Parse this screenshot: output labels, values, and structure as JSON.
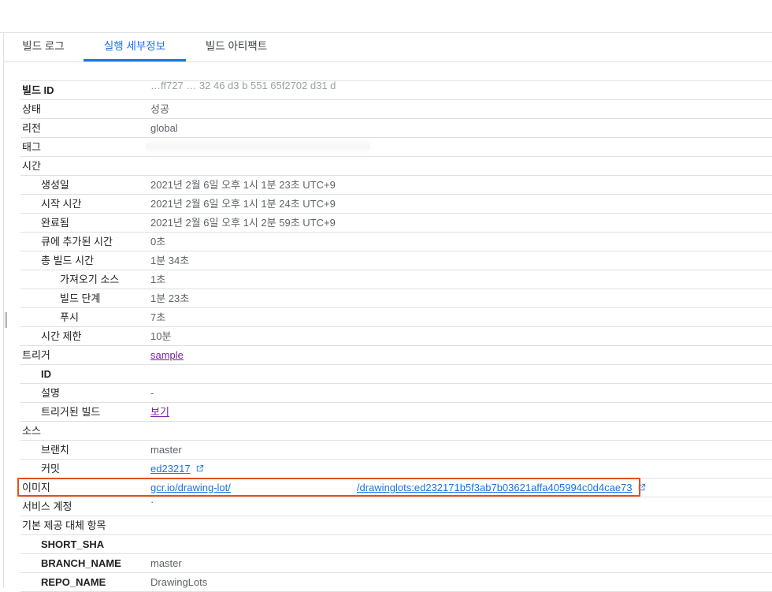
{
  "tabs": [
    {
      "label": "빌드 로그"
    },
    {
      "label": "실행 세부정보"
    },
    {
      "label": "빌드 아티팩트"
    }
  ],
  "rows": {
    "build_id": {
      "label": "빌드 ID",
      "value": "…ff727 … 32 46 d3 b 551 65f2702 d31 d"
    },
    "status": {
      "label": "상태",
      "value": "성공"
    },
    "region": {
      "label": "리전",
      "value": "global"
    },
    "tags": {
      "label": "태그",
      "value": ""
    },
    "time": {
      "label": "시간"
    },
    "created": {
      "label": "생성일",
      "value": "2021년 2월 6일 오후 1시 1분 23초 UTC+9"
    },
    "started": {
      "label": "시작 시간",
      "value": "2021년 2월 6일 오후 1시 1분 24초 UTC+9"
    },
    "finished": {
      "label": "완료됨",
      "value": "2021년 2월 6일 오후 1시 2분 59초 UTC+9"
    },
    "queued": {
      "label": "큐에 추가된 시간",
      "value": "0초"
    },
    "total_build": {
      "label": "총 빌드 시간",
      "value": "1분 34초"
    },
    "fetch_source": {
      "label": "가져오기 소스",
      "value": "1초"
    },
    "build_steps": {
      "label": "빌드 단계",
      "value": "1분 23초"
    },
    "push": {
      "label": "푸시",
      "value": "7초"
    },
    "timeout": {
      "label": "시간 제한",
      "value": "10분"
    },
    "trigger": {
      "label": "트리거",
      "value": "sample"
    },
    "trigger_id": {
      "label": "ID",
      "value": ""
    },
    "description": {
      "label": "설명",
      "value": "-"
    },
    "triggered_builds": {
      "label": "트리거된 빌드",
      "value": "보기"
    },
    "source": {
      "label": "소스"
    },
    "branch": {
      "label": "브랜치",
      "value": "master"
    },
    "commit": {
      "label": "커밋",
      "value": "ed23217"
    },
    "image": {
      "label": "이미지",
      "value_prefix": "gcr.io/drawing-lot/",
      "value_suffix": "/drawinglots:ed232171b5f3ab7b03621affa405994c0d4cae73"
    },
    "service_account": {
      "label": "서비스 계정",
      "value": "·"
    },
    "substitutions": {
      "label": "기본 제공 대체 항목"
    },
    "short_sha": {
      "label": "SHORT_SHA",
      "value": ""
    },
    "branch_name": {
      "label": "BRANCH_NAME",
      "value": "master"
    },
    "repo_name": {
      "label": "REPO_NAME",
      "value": "DrawingLots"
    }
  },
  "icons": {
    "external_link": "external-link-icon"
  },
  "colors": {
    "accent": "#1a73e8",
    "visited": "#7b1fa2",
    "highlight": "#e0521d"
  }
}
